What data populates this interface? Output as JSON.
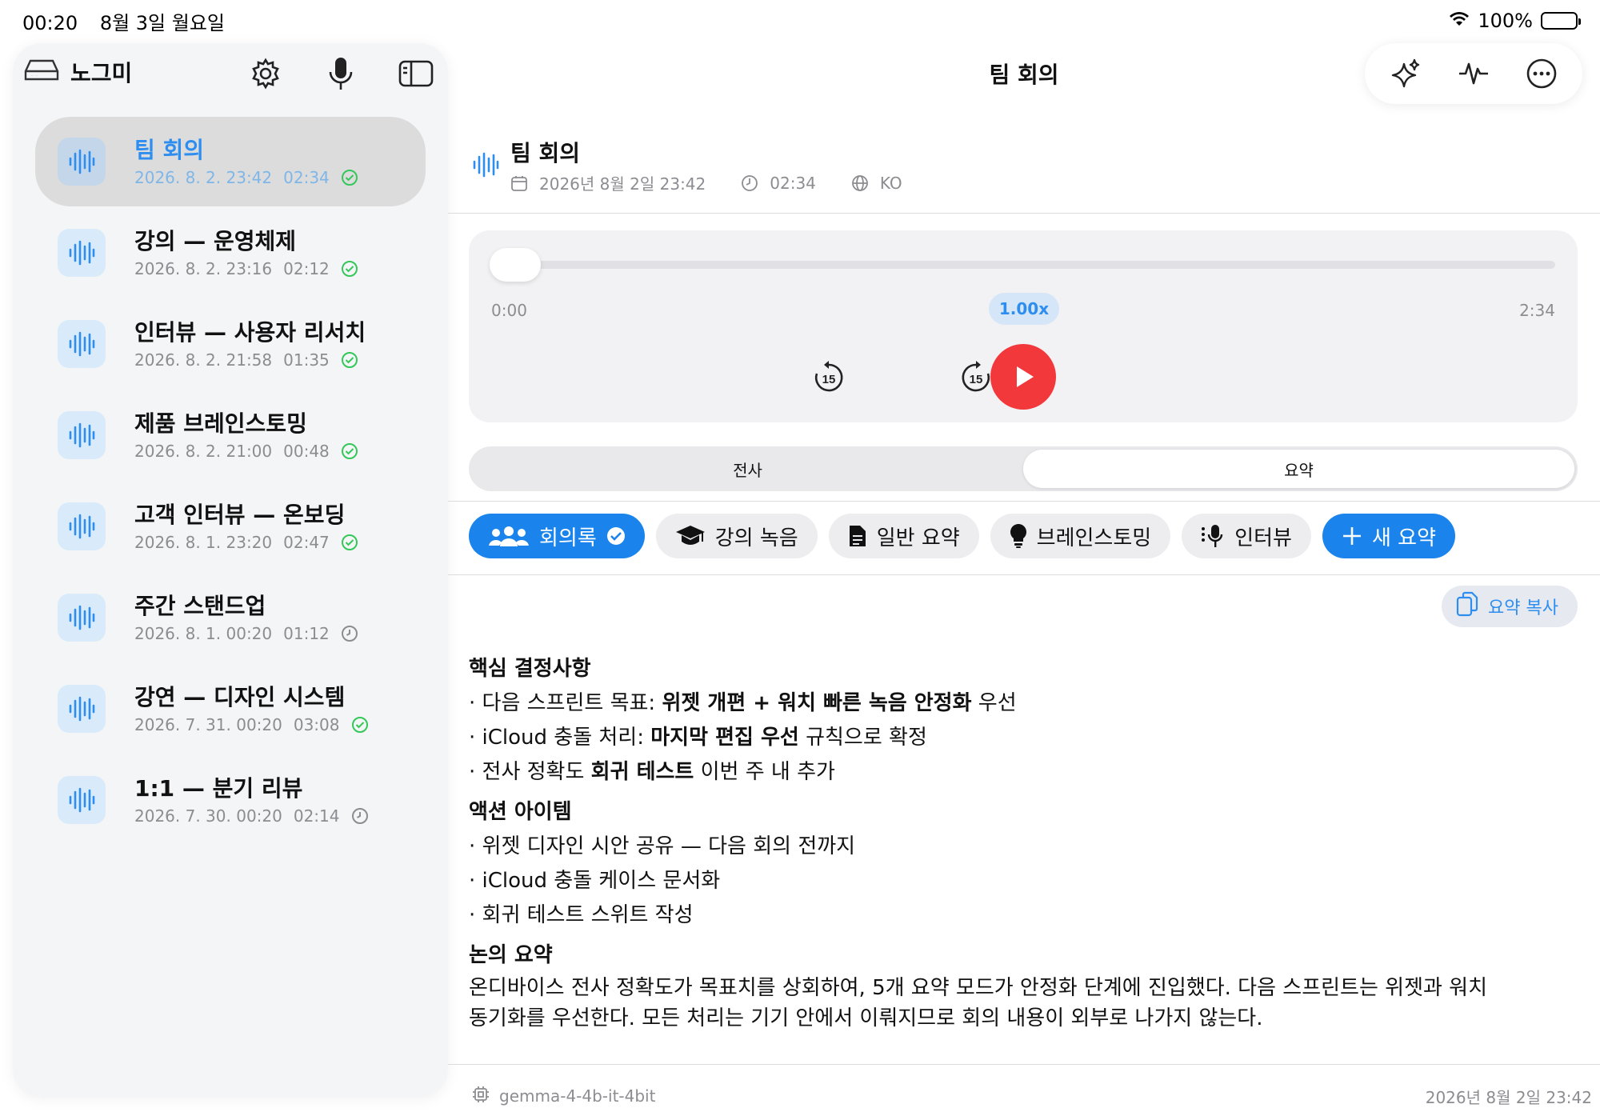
{
  "status_bar": {
    "time": "00:20",
    "date": "8월 3일 월요일",
    "battery": "100%"
  },
  "sidebar": {
    "app_name": "노그미",
    "recordings": [
      {
        "title": "팀 회의",
        "date": "2026. 8. 2. 23:42",
        "duration": "02:34",
        "status": "done",
        "selected": true
      },
      {
        "title": "강의 — 운영체제",
        "date": "2026. 8. 2. 23:16",
        "duration": "02:12",
        "status": "done"
      },
      {
        "title": "인터뷰 — 사용자 리서치",
        "date": "2026. 8. 2. 21:58",
        "duration": "01:35",
        "status": "done"
      },
      {
        "title": "제품 브레인스토밍",
        "date": "2026. 8. 2. 21:00",
        "duration": "00:48",
        "status": "done"
      },
      {
        "title": "고객 인터뷰 — 온보딩",
        "date": "2026. 8. 1. 23:20",
        "duration": "02:47",
        "status": "done"
      },
      {
        "title": "주간 스탠드업",
        "date": "2026. 8. 1. 00:20",
        "duration": "01:12",
        "status": "pending"
      },
      {
        "title": "강연 — 디자인 시스템",
        "date": "2026. 7. 31. 00:20",
        "duration": "03:08",
        "status": "done"
      },
      {
        "title": "1:1 — 분기 리뷰",
        "date": "2026. 7. 30. 00:20",
        "duration": "02:14",
        "status": "pending"
      }
    ]
  },
  "main": {
    "title": "팀 회의",
    "recording": {
      "title": "팀 회의",
      "datetime": "2026년 8월 2일 23:42",
      "duration": "02:34",
      "language": "KO"
    },
    "player": {
      "current": "0:00",
      "total": "2:34",
      "speed": "1.00x",
      "skip_seconds": "15",
      "progress": 0.0
    },
    "segments": [
      {
        "label": "전사"
      },
      {
        "label": "요약",
        "active": true
      }
    ],
    "summary_modes": [
      {
        "label": "회의록",
        "icon": "people-icon",
        "active": true
      },
      {
        "label": "강의 녹음",
        "icon": "graduation-cap-icon"
      },
      {
        "label": "일반 요약",
        "icon": "document-icon"
      },
      {
        "label": "브레인스토밍",
        "icon": "lightbulb-icon"
      },
      {
        "label": "인터뷰",
        "icon": "interview-mic-icon"
      }
    ],
    "new_summary_label": "새 요약",
    "copy_label": "요약 복사",
    "summary": {
      "decisions_heading": "핵심 결정사항",
      "decisions": [
        {
          "a": "다음 스프린트 목표: ",
          "b": "위젯 개편 + 워치 빠른 녹음 안정화",
          "c": " 우선"
        },
        {
          "a": "iCloud 충돌 처리: ",
          "b": "마지막 편집 우선",
          "c": " 규칙으로 확정"
        },
        {
          "a": "전사 정확도 ",
          "b": "회귀 테스트",
          "c": " 이번 주 내 추가"
        }
      ],
      "actions_heading": "액션 아이템",
      "actions": [
        "위젯 디자인 시안 공유 — 다음 회의 전까지",
        "iCloud 충돌 케이스 문서화",
        "회귀 테스트 스위트 작성"
      ],
      "discussion_heading": "논의 요약",
      "discussion_lines": [
        "온디바이스 전사 정확도가 목표치를 상회하여, 5개 요약 모드가 안정화 단계에 진입했다. 다음 스프린트는 위젯과 워치",
        "동기화를 우선한다. 모든 처리는 기기 안에서 이뤄지므로 회의 내용이 외부로 나가지 않는다."
      ]
    },
    "footer": {
      "model": "gemma-4-4b-it-4bit",
      "timestamp": "2026년 8월 2일 23:42"
    }
  },
  "colors": {
    "accent": "#1a84ec",
    "play": "#f2383a",
    "done": "#34c759"
  }
}
